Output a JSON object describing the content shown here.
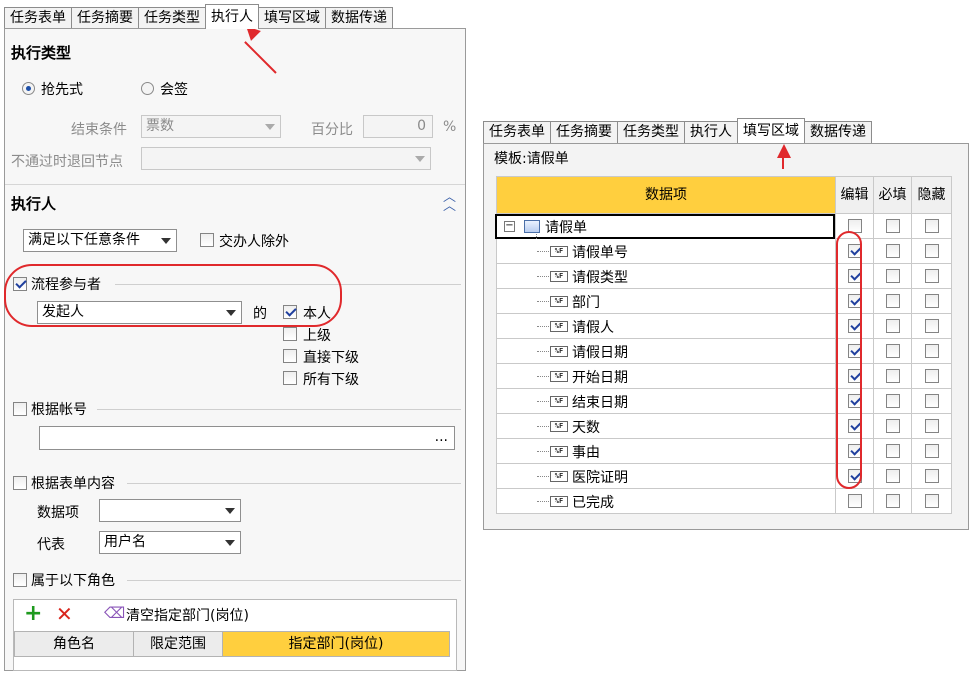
{
  "left": {
    "tabs": [
      "任务表单",
      "任务摘要",
      "任务类型",
      "执行人",
      "填写区域",
      "数据传递"
    ],
    "active_tab": 3,
    "exec_type": {
      "title": "执行类型",
      "radio1": "抢先式",
      "radio2": "会签",
      "end_condition_label": "结束条件",
      "end_condition_value": "票数",
      "percent_label": "百分比",
      "percent_value": "0",
      "percent_unit": "%",
      "reject_label": "不通过时退回节点",
      "reject_value": ""
    },
    "executor": {
      "title": "执行人",
      "collapse_icon": "double-chevron-up-icon",
      "condition_value": "满足以下任意条件",
      "exclude_label": "交办人除外",
      "participants_label": "流程参与者",
      "participants_value": "发起人",
      "of_label": "的",
      "opt_self": "本人",
      "opt_superior": "上级",
      "opt_direct": "直接下级",
      "opt_all": "所有下级",
      "by_account_label": "根据帐号",
      "account_button": "...",
      "by_form_label": "根据表单内容",
      "data_item_label": "数据项",
      "data_item_value": "",
      "represent_label": "代表",
      "represent_value": "用户名",
      "by_role_label": "属于以下角色",
      "clear_dept_label": "清空指定部门(岗位)",
      "role_columns": [
        "角色名",
        "限定范围",
        "指定部门(岗位)"
      ]
    }
  },
  "right": {
    "tabs": [
      "任务表单",
      "任务摘要",
      "任务类型",
      "执行人",
      "填写区域",
      "数据传递"
    ],
    "active_tab": 4,
    "template_label": "模板:请假单",
    "columns": [
      "数据项",
      "编辑",
      "必填",
      "隐藏"
    ],
    "root": "请假单",
    "rows": [
      {
        "name": "请假单号",
        "edit": true
      },
      {
        "name": "请假类型",
        "edit": true
      },
      {
        "name": "部门",
        "edit": true
      },
      {
        "name": "请假人",
        "edit": true
      },
      {
        "name": "请假日期",
        "edit": true
      },
      {
        "name": "开始日期",
        "edit": true
      },
      {
        "name": "结束日期",
        "edit": true
      },
      {
        "name": "天数",
        "edit": true
      },
      {
        "name": "事由",
        "edit": true
      },
      {
        "name": "医院证明",
        "edit": true
      },
      {
        "name": "已完成",
        "edit": false
      }
    ],
    "field_icon_text": "%F",
    "annotation_color": "#e0292c",
    "header_highlight": "#ffcf3e"
  }
}
